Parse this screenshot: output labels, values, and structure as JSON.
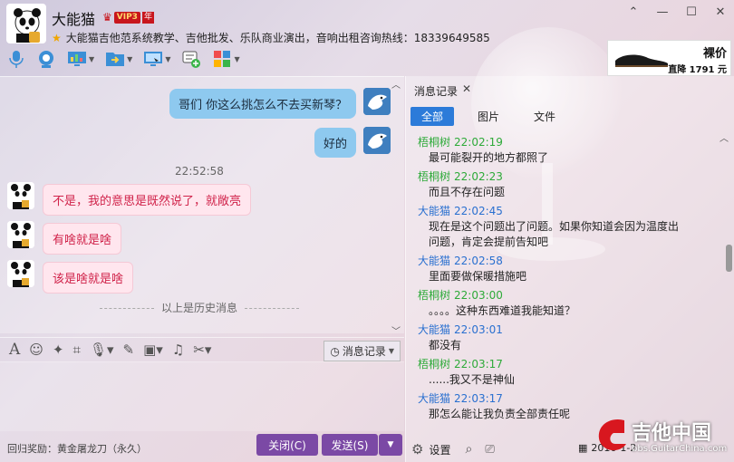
{
  "header": {
    "nickname": "大能猫",
    "vip_label": "VIP3",
    "year_label": "年",
    "signature": "大能猫吉他范系统教学、吉他批发、乐队商业演出，音响出租咨询热线：18339649585"
  },
  "window_controls": {
    "pin": "⌃",
    "minimize": "—",
    "maximize": "☐",
    "close": "✕"
  },
  "toolbar": {
    "items": [
      "microphone-icon",
      "video-icon",
      "screen-share-icon",
      "file-transfer-icon",
      "remote-desktop-icon",
      "app-add-icon",
      "app-grid-icon"
    ]
  },
  "ad": {
    "tag": "裸价",
    "price": "直降 1791 元"
  },
  "chat": {
    "messages_right": [
      {
        "text": "哥们 你这么挑怎么不去买新琴？"
      },
      {
        "text": "好的"
      }
    ],
    "timestamp": "22:52:58",
    "messages_left": [
      {
        "text": "不是，我的意思是既然说了，就敞亮"
      },
      {
        "text": "有啥就是啥"
      },
      {
        "text": "该是啥就是啥"
      }
    ],
    "history_notice": "以上是历史消息"
  },
  "input_toolbar": {
    "history_button": "消息记录"
  },
  "footer": {
    "reward": "回归奖励：黄金屠龙刀（永久）",
    "close_label": "关闭(C)",
    "send_label": "发送(S)"
  },
  "right_panel": {
    "title": "消息记录",
    "tabs": [
      "全部",
      "图片",
      "文件"
    ],
    "records": [
      {
        "sender": "梧桐树",
        "time": "22:02:19",
        "color": "green",
        "lines": [
          "最可能裂开的地方都照了"
        ]
      },
      {
        "sender": "梧桐树",
        "time": "22:02:23",
        "color": "green",
        "lines": [
          "而且不存在问题"
        ]
      },
      {
        "sender": "大能猫",
        "time": "22:02:45",
        "color": "blue",
        "lines": [
          "现在是这个问题出了问题。如果你知道会因为温度出",
          "问题，肯定会提前告知吧"
        ]
      },
      {
        "sender": "大能猫",
        "time": "22:02:58",
        "color": "blue",
        "lines": [
          "里面要做保暖措施吧"
        ]
      },
      {
        "sender": "梧桐树",
        "time": "22:03:00",
        "color": "green",
        "lines": [
          "。。。。这种东西难道我能知道？"
        ]
      },
      {
        "sender": "大能猫",
        "time": "22:03:01",
        "color": "blue",
        "lines": [
          "都没有"
        ]
      },
      {
        "sender": "梧桐树",
        "time": "22:03:17",
        "color": "green",
        "lines": [
          "......我又不是神仙"
        ]
      },
      {
        "sender": "大能猫",
        "time": "22:03:17",
        "color": "blue",
        "lines": [
          "那怎么能让我负责全部责任呢"
        ]
      }
    ],
    "settings_label": "设置",
    "date": "2016-1-2"
  },
  "watermark": {
    "main": "吉他中国",
    "sub": "bbs.GuitarChina.com"
  },
  "colors": {
    "accent": "#7b49a5",
    "tab_active": "#2c7bd9",
    "green_name": "#2eaa39",
    "blue_name": "#2a70d0"
  }
}
